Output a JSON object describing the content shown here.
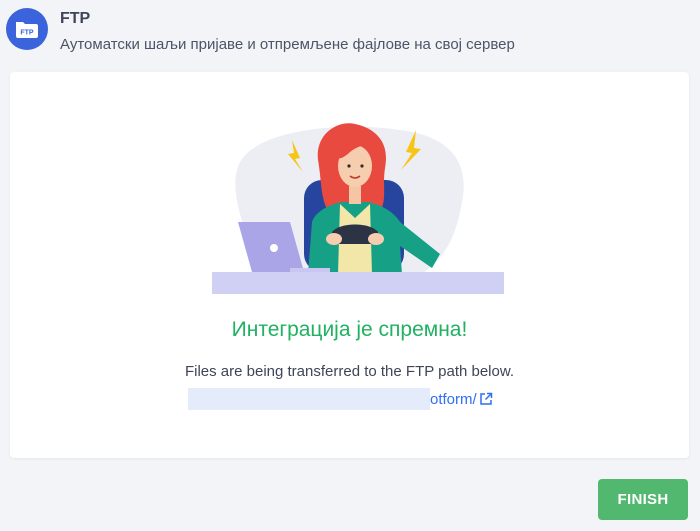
{
  "header": {
    "icon": "ftp-folder-icon",
    "icon_label": "FTP",
    "title": "FTP",
    "subtitle": "Аутоматски шаљи пријаве и отпремљене фајлове на свој сервер"
  },
  "card": {
    "illustration": "woman-at-desk-with-laptop-illustration",
    "status_title": "Интеграција је спремна!",
    "status_description": "Files are being transferred to the FTP path below.",
    "path_visible_text": "otform/",
    "path_icon": "external-link-icon"
  },
  "actions": {
    "finish_label": "FINISH"
  },
  "colors": {
    "accent_blue": "#3b63dc",
    "success_green": "#20b161",
    "button_green": "#52b86f",
    "link_blue": "#2f6ff0"
  }
}
